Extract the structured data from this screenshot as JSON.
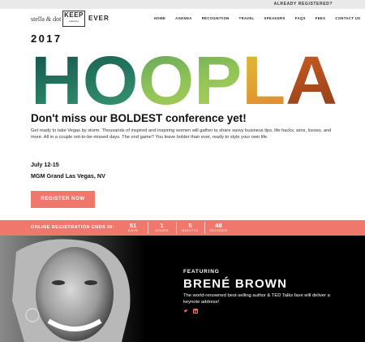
{
  "topbar": {
    "already_registered": "ALREADY REGISTERED?"
  },
  "header": {
    "logo_brand": "stella & dot",
    "logo_keep": "KEEP",
    "logo_keep_sub": "collective",
    "logo_ever": "EVER",
    "nav": [
      "HOME",
      "AGENDA",
      "RECOGNITION",
      "TRAVEL",
      "SPEAKERS",
      "FAQS",
      "FEES",
      "CONTACT US"
    ]
  },
  "hero": {
    "year": "2017",
    "wordmark": "HOOPLA",
    "headline": "Don't miss our BOLDEST conference yet!",
    "description": "Get ready to take Vegas by storm. Thousands of inspired and inspiring women will gather to share savvy business tips, life hacks, wins, losses, and more. All in a couple not-to-be-missed days. The end game? You leave bolder than ever, ready to style your own life.",
    "dates": "July 12-15",
    "venue": "MGM Grand Las Vegas, NV",
    "cta": "REGISTER NOW"
  },
  "countdown": {
    "label": "ONLINE REGISTRATION ENDS IN:",
    "units": [
      {
        "value": "51",
        "unit": "DAYS"
      },
      {
        "value": "1",
        "unit": "HOURS"
      },
      {
        "value": "5",
        "unit": "MINUTES"
      },
      {
        "value": "48",
        "unit": "SECONDS"
      }
    ]
  },
  "featuring": {
    "label": "FEATURING",
    "speaker": "BRENÉ BROWN",
    "bio": "The world-renowned best-selling author & TED Talks fave will deliver a keynote address!",
    "social_icons": [
      "twitter-icon",
      "linkedin-icon"
    ]
  },
  "colors": {
    "accent": "#f0776c",
    "dark": "#000000"
  }
}
